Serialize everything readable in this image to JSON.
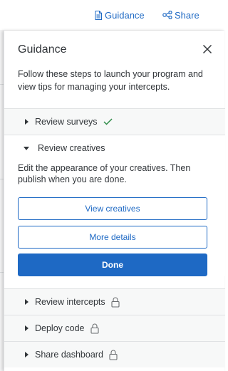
{
  "topbar": {
    "guidance_label": "Guidance",
    "share_label": "Share",
    "guidance_icon": "document-icon",
    "share_icon": "share-icon",
    "link_color": "#1e69c4"
  },
  "panel": {
    "title": "Guidance",
    "intro": "Follow these steps to launch your program and view tips for managing your intercepts.",
    "steps": [
      {
        "label": "Review surveys",
        "state": "complete",
        "icon": "checkmark-icon"
      },
      {
        "label": "Review creatives",
        "state": "expanded",
        "description": "Edit the appearance of your creatives. Then publish when you are done.",
        "buttons": {
          "view": "View creatives",
          "more": "More details",
          "done": "Done"
        }
      },
      {
        "label": "Review intercepts",
        "state": "locked",
        "icon": "lock-icon"
      },
      {
        "label": "Deploy code",
        "state": "locked",
        "icon": "lock-icon"
      },
      {
        "label": "Share dashboard",
        "state": "locked",
        "icon": "lock-icon"
      }
    ]
  },
  "colors": {
    "accent": "#1e69c4",
    "check": "#2e8b47",
    "lock": "#6a6d70"
  }
}
